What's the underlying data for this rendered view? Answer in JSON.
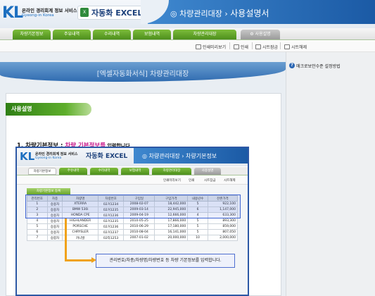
{
  "header": {
    "logo_mark": "KL",
    "logo_title": "온라인 경리회계 정보 서비스",
    "logo_sub": "Gyeong-in Korea",
    "app_name": "자동화 EXCEL",
    "excel_icon": "excel-icon",
    "breadcrumb": "차량관리대장",
    "page_title": "사용설명서"
  },
  "tabs": [
    {
      "label": "차량기본정보"
    },
    {
      "label": "주유내역"
    },
    {
      "label": "수리내역"
    },
    {
      "label": "보험내역"
    },
    {
      "label": "차량관리대장"
    },
    {
      "label": "사용설명"
    }
  ],
  "toolbar": {
    "preview": "인쇄미리보기",
    "print": "인쇄",
    "unlock": "시트잠금",
    "sheet_protect": "시트해제"
  },
  "right_panel": {
    "help_link": "매크로보안수준 설정방법"
  },
  "banner": {
    "title": "[엑셀자동화서식] 차량관리대장"
  },
  "content": {
    "section_pill": "사용설명",
    "step1_title": "1. 차량기본정보 : ",
    "step1_highlight": "차량 기본정보를",
    "step1_rest": " 입력합니다"
  },
  "embedded": {
    "logo_mark": "KL",
    "logo_title": "온라인 경리회계 정보 서비스",
    "logo_sub": "Gyeong-in Korea",
    "app_name": "자동화 EXCEL",
    "breadcrumb": "차량관리대장",
    "page_title": "차량기본정보",
    "tabs": [
      "차량기본정보",
      "주유내역",
      "수리내역",
      "보험내역",
      "차량관리대장",
      "사용설명"
    ],
    "tools": [
      "인쇄미리보기",
      "인쇄",
      "시트잠금",
      "시트해제"
    ],
    "green_button": "차량기본정보 등록",
    "table": {
      "headers": [
        "관리번호",
        "차종",
        "차량명",
        "차량번호",
        "구입일",
        "구입가격",
        "내용년수",
        "잔존가격"
      ],
      "rows": [
        [
          "1",
          "승용차",
          "XTERRA",
          "02거1234",
          "2008-02-07",
          "18,442,000",
          "5",
          "922,100"
        ],
        [
          "2",
          "승용차",
          "BMW 530i",
          "02거1235",
          "2009-03-14",
          "22,945,000",
          "6",
          "1,147,000"
        ],
        [
          "3",
          "승용차",
          "HONDA CPE",
          "02거1236",
          "2009-04-19",
          "12,666,000",
          "4",
          "633,300"
        ],
        [
          "4",
          "승용차",
          "HIGHLANDER",
          "02거1235",
          "2010-05-25",
          "17,866,000",
          "5",
          "893,300"
        ],
        [
          "5",
          "승용차",
          "PORSCHE",
          "02거1236",
          "2010-06-29",
          "17,180,000",
          "5",
          "859,000"
        ],
        [
          "6",
          "승용차",
          "CHRYSLER",
          "02거1237",
          "2010-08-04",
          "16,141,000",
          "5",
          "807,050"
        ],
        [
          "7",
          "승합차",
          "카니발",
          "02타1253",
          "2007-01-02",
          "20,000,000",
          "10",
          "2,000,000"
        ]
      ]
    },
    "callout": "관리번호/차종/차량명/차량번호 등 차량 기본정보를 입력합니다."
  }
}
